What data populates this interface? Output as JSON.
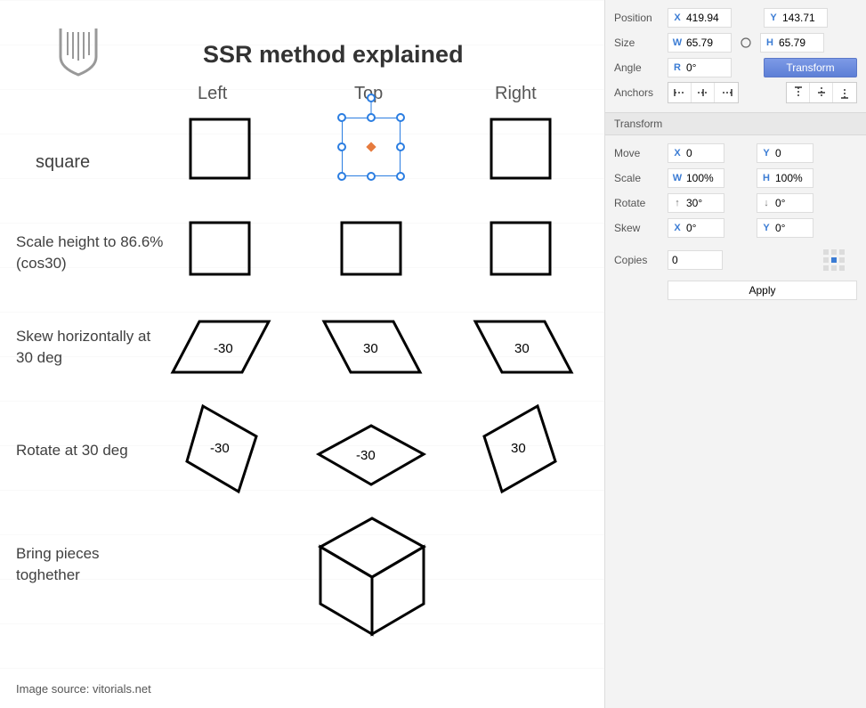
{
  "canvas": {
    "title": "SSR method explained",
    "columns": [
      "Left",
      "Top",
      "Right"
    ],
    "rows": [
      "square",
      "Scale height to 86.6% (cos30)",
      "Skew horizontally at 30 deg",
      "Rotate at 30 deg",
      "Bring pieces toghether"
    ],
    "shape_labels": {
      "skew": [
        "-30",
        "30",
        "30"
      ],
      "rotate": [
        "-30",
        "-30",
        "30"
      ]
    },
    "footer": "Image source: vitorials.net"
  },
  "panel": {
    "position_label": "Position",
    "size_label": "Size",
    "angle_label": "Angle",
    "anchors_label": "Anchors",
    "position": {
      "x": "419.94",
      "y": "143.71"
    },
    "size": {
      "w": "65.79",
      "h": "65.79"
    },
    "angle": "0°",
    "transform_button": "Transform",
    "section_transform": "Transform",
    "move_label": "Move",
    "scale_label": "Scale",
    "rotate_label": "Rotate",
    "skew_label": "Skew",
    "copies_label": "Copies",
    "move": {
      "x": "0",
      "y": "0"
    },
    "scale": {
      "w": "100%",
      "h": "100%"
    },
    "rotate": {
      "ccw": "30°",
      "cw": "0°"
    },
    "skew": {
      "x": "0°",
      "y": "0°"
    },
    "copies": "0",
    "apply": "Apply"
  }
}
